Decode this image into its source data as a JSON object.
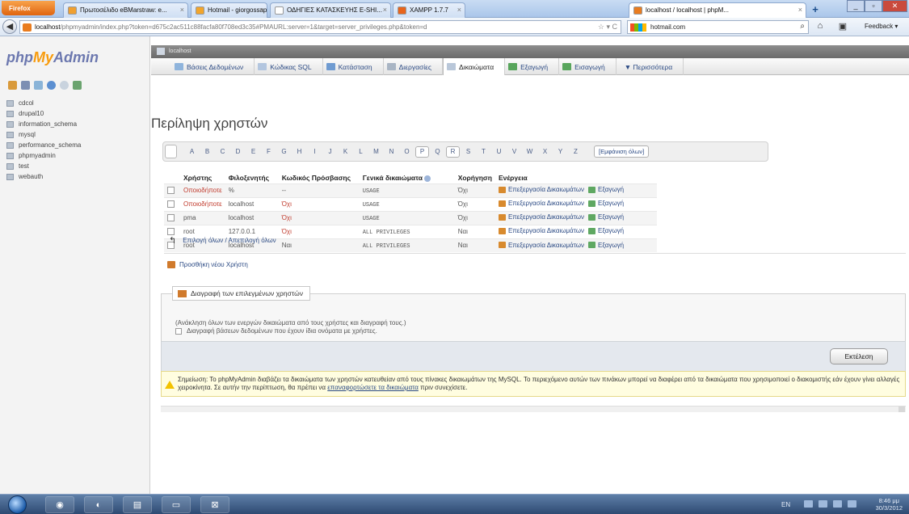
{
  "browser": {
    "menu_button": "Firefox",
    "tabs": [
      {
        "label": "Πρωτοσέλιδο eBMarstraw: e...",
        "icon_color": "#f0a030",
        "active": false
      },
      {
        "label": "Hotmail - giorgossap86@ho...",
        "icon_color": "#f2a52b",
        "active": false
      },
      {
        "label": "ΟΔΗΓΙΕΣ ΚΑΤΑΣΚΕΥΗΣ E-SHI...",
        "icon_color": "#ffffff",
        "active": false
      },
      {
        "label": "XAMPP 1.7.7",
        "icon_color": "#e8641b",
        "active": false
      },
      {
        "label": "localhost / localhost | phpM...",
        "icon_color": "#e97c1f",
        "active": true
      }
    ],
    "new_tab": "+",
    "url_host": "localhost",
    "url_rest": "/phpmyadmin/index.php?token=d675c2ac511c88facfa80f708ed3c35#PMAURL:server=1&target=server_privileges.php&token=d",
    "url_tail": "☆ ▾ C",
    "search_text": "hotmail.com",
    "feedback": "Feedback ▾"
  },
  "pma": {
    "logo_php": "php",
    "logo_my": "My",
    "logo_admin": "Admin",
    "databases": [
      "cdcol",
      "drupal10",
      "information_schema",
      "mysql",
      "performance_schema",
      "phpmyadmin",
      "test",
      "webauth"
    ],
    "server_label": "localhost",
    "menu": [
      {
        "label": "Βάσεις Δεδομένων",
        "icon_color": "#8fb4dc",
        "active": false
      },
      {
        "label": "Κώδικας SQL",
        "icon_color": "#b3c6df",
        "active": false
      },
      {
        "label": "Κατάσταση",
        "icon_color": "#6f9bd1",
        "active": false
      },
      {
        "label": "Διεργασίες",
        "icon_color": "#a9b5c4",
        "active": false
      },
      {
        "label": "Δικαιώματα",
        "icon_color": "#b9c7d9",
        "active": true
      },
      {
        "label": "Εξαγωγή",
        "icon_color": "#58a55c",
        "active": false
      },
      {
        "label": "Εισαγωγή",
        "icon_color": "#58a55c",
        "active": false
      },
      {
        "label": "▼ Περισσότερα",
        "icon_color": "",
        "active": false
      }
    ],
    "page_title": "Περίληψη χρηστών",
    "letters": [
      "A",
      "B",
      "C",
      "D",
      "E",
      "F",
      "G",
      "H",
      "I",
      "J",
      "K",
      "L",
      "M",
      "N",
      "O",
      "P",
      "Q",
      "R",
      "S",
      "T",
      "U",
      "V",
      "W",
      "X",
      "Y",
      "Z"
    ],
    "boxed_letters": [
      "P",
      "R"
    ],
    "show_all": "[Εμφάνιση όλων]",
    "table": {
      "headers": [
        "Χρήστης",
        "Φιλοξενητής",
        "Κωδικός Πρόσβασης",
        "Γενικά δικαιώματα",
        "Χορήγηση",
        "Ενέργεια"
      ],
      "rows": [
        {
          "user": "Οποιοδήποτε",
          "host": "%",
          "password": "--",
          "privileges": "USAGE",
          "grant": "Όχι",
          "edit": "Επεξεργασία Δικαιωμάτων",
          "export": "Εξαγωγή"
        },
        {
          "user": "Οποιοδήποτε",
          "host": "localhost",
          "password": "Όχι",
          "privileges": "USAGE",
          "grant": "Όχι",
          "edit": "Επεξεργασία Δικαιωμάτων",
          "export": "Εξαγωγή"
        },
        {
          "user": "pma",
          "host": "localhost",
          "password": "Όχι",
          "privileges": "USAGE",
          "grant": "Όχι",
          "edit": "Επεξεργασία Δικαιωμάτων",
          "export": "Εξαγωγή"
        },
        {
          "user": "root",
          "host": "127.0.0.1",
          "password": "Όχι",
          "privileges": "ALL PRIVILEGES",
          "grant": "Ναι",
          "edit": "Επεξεργασία Δικαιωμάτων",
          "export": "Εξαγωγή"
        },
        {
          "user": "root",
          "host": "localhost",
          "password": "Ναι",
          "privileges": "ALL PRIVILEGES",
          "grant": "Ναι",
          "edit": "Επεξεργασία Δικαιωμάτων",
          "export": "Εξαγωγή"
        }
      ]
    },
    "check_all": "Επιλογή όλων / Απεπιλογή όλων",
    "add_user": "Προσθήκη νέου Χρήστη",
    "delete_legend": "Διαγραφή των επιλεγμένων χρηστών",
    "delete_note": "(Ανάκληση όλων των ενεργών δικαιώματα από τους χρήστες και διαγραφή τους.)",
    "delete_db_label": "Διαγραφή βάσεων δεδομένων που έχουν ίδια ονόματα με χρήστες.",
    "execute": "Εκτέλεση",
    "notice_text": "Σημείωση: Το phpMyAdmin διαβάζει τα δικαιώματα των χρηστών κατευθείαν από τους πίνακες δικαιωμάτων της MySQL. Το περιεχόμενο αυτών των πινάκων μπορεί να διαφέρει από τα δικαιώματα που χρησιμοποιεί ο διακομιστής εάν έχουν γίνει αλλαγές χειροκίνητα. Σε αυτήν την περίπτωση, θα πρέπει να",
    "notice_link": "επαναφορτώσετε τα δικαιώματα",
    "notice_end": "πριν συνεχίσετε."
  },
  "taskbar": {
    "apps": [
      "◉",
      "◐",
      "▤",
      "▭",
      "⊠"
    ],
    "lang": "EN",
    "time": "8:46 μμ",
    "date": "30/3/2012"
  }
}
